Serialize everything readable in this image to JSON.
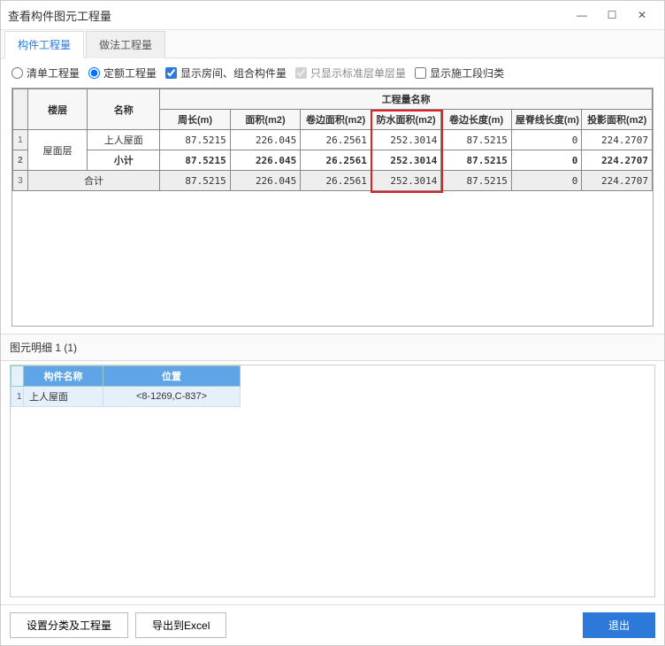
{
  "window": {
    "title": "查看构件图元工程量"
  },
  "tabs": [
    {
      "label": "构件工程量",
      "active": true
    },
    {
      "label": "做法工程量",
      "active": false
    }
  ],
  "options": {
    "radio_list": {
      "label": "清单工程量",
      "checked": false
    },
    "radio_quota": {
      "label": "定额工程量",
      "checked": true
    },
    "chk_show_room": {
      "label": "显示房间、组合构件量",
      "checked": true
    },
    "chk_only_single": {
      "label": "只显示标准层单层量",
      "checked": true,
      "disabled": true
    },
    "chk_section": {
      "label": "显示施工段归类",
      "checked": false
    }
  },
  "grid": {
    "group_header": "工程量名称",
    "row_headers": {
      "floor": "楼层",
      "name": "名称"
    },
    "metrics": [
      "周长(m)",
      "面积(m2)",
      "卷边面积(m2)",
      "防水面积(m2)",
      "卷边长度(m)",
      "屋脊线长度(m)",
      "投影面积(m2)"
    ],
    "rows": [
      {
        "rownum": "1",
        "floor": "屋面层",
        "name": "上人屋面",
        "values": [
          "87.5215",
          "226.045",
          "26.2561",
          "252.3014",
          "87.5215",
          "0",
          "224.2707"
        ],
        "style": "normal"
      },
      {
        "rownum": "2",
        "floor": "",
        "name": "小计",
        "values": [
          "87.5215",
          "226.045",
          "26.2561",
          "252.3014",
          "87.5215",
          "0",
          "224.2707"
        ],
        "style": "subtotal"
      },
      {
        "rownum": "3",
        "floor": "合计",
        "name": "",
        "values": [
          "87.5215",
          "226.045",
          "26.2561",
          "252.3014",
          "87.5215",
          "0",
          "224.2707"
        ],
        "style": "total",
        "merge_floor_name": true
      }
    ],
    "highlight_metric_index": 3
  },
  "detail": {
    "title": "图元明细  1 (1)",
    "headers": {
      "name": "构件名称",
      "pos": "位置"
    },
    "rows": [
      {
        "rownum": "1",
        "name": "上人屋面",
        "pos": "<8-1269,C-837>"
      }
    ]
  },
  "footer": {
    "category_btn": "设置分类及工程量",
    "export_btn": "导出到Excel",
    "exit_btn": "退出"
  }
}
